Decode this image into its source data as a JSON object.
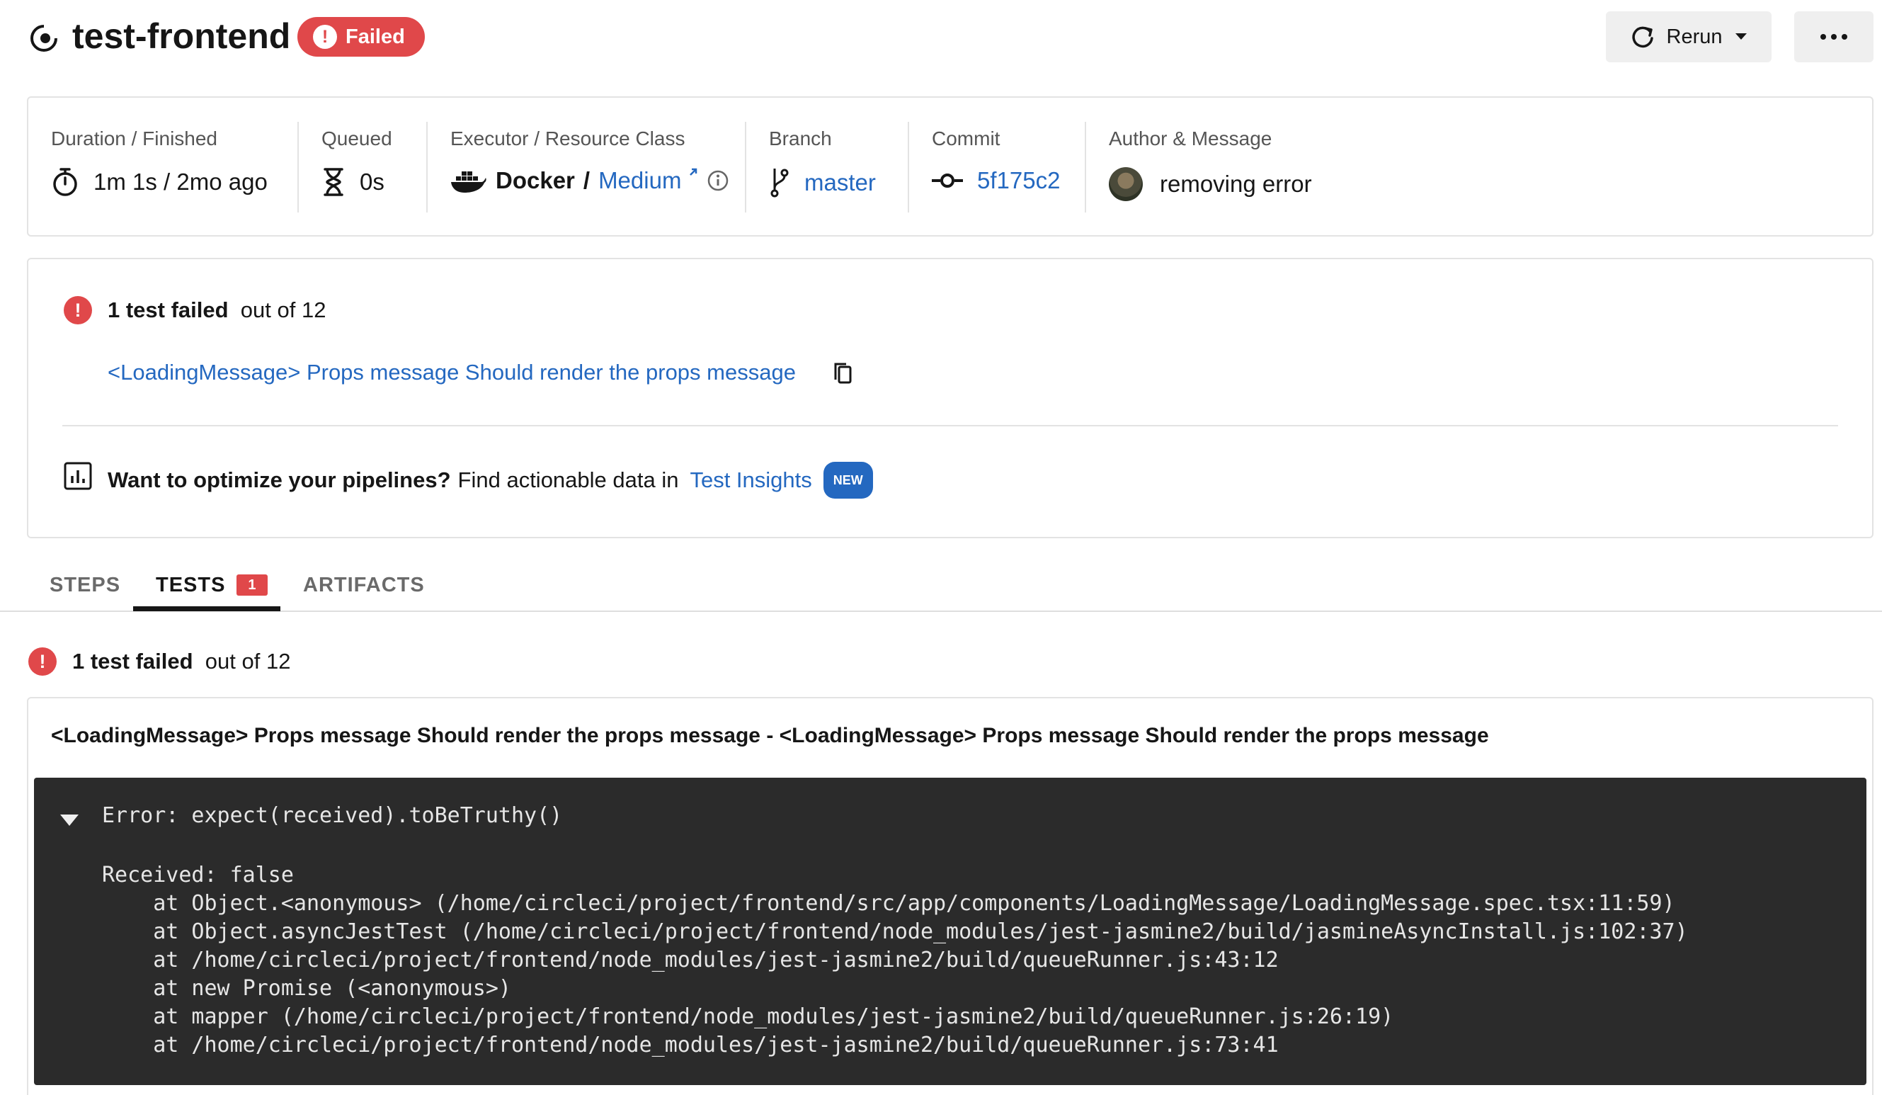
{
  "header": {
    "job_name": "test-frontend",
    "status": "Failed",
    "rerun_label": "Rerun",
    "more_label": "•••"
  },
  "info": {
    "duration_label": "Duration / Finished",
    "duration_value": "1m 1s / 2mo ago",
    "queued_label": "Queued",
    "queued_value": "0s",
    "executor_label": "Executor / Resource Class",
    "executor_value": "Docker",
    "executor_sep": "/",
    "resource_class": "Medium",
    "branch_label": "Branch",
    "branch_value": "master",
    "commit_label": "Commit",
    "commit_value": "5f175c2",
    "author_label": "Author & Message",
    "author_message": "removing error"
  },
  "failed_summary": {
    "count_text": "1 test failed",
    "out_of_text": "out of 12",
    "test_name": "<LoadingMessage> Props message Should render the props message",
    "optimize_bold": "Want to optimize your pipelines?",
    "optimize_text": "Find actionable data in",
    "insights_link": "Test Insights",
    "new_badge": "NEW"
  },
  "tabs": [
    {
      "label": "STEPS"
    },
    {
      "label": "TESTS",
      "count": "1"
    },
    {
      "label": "ARTIFACTS"
    }
  ],
  "results": {
    "count_text": "1 test failed",
    "out_of_text": "out of 12",
    "test_title": "<LoadingMessage> Props message Should render the props message - <LoadingMessage> Props message Should render the props message",
    "error_line": "Error: expect(received).toBeTruthy()",
    "received_line": "Received: false",
    "stack": [
      "    at Object.<anonymous> (/home/circleci/project/frontend/src/app/components/LoadingMessage/LoadingMessage.spec.tsx:11:59)",
      "    at Object.asyncJestTest (/home/circleci/project/frontend/node_modules/jest-jasmine2/build/jasmineAsyncInstall.js:102:37)",
      "    at /home/circleci/project/frontend/node_modules/jest-jasmine2/build/queueRunner.js:43:12",
      "    at new Promise (<anonymous>)",
      "    at mapper (/home/circleci/project/frontend/node_modules/jest-jasmine2/build/queueRunner.js:26:19)",
      "    at /home/circleci/project/frontend/node_modules/jest-jasmine2/build/queueRunner.js:73:41"
    ]
  },
  "colors": {
    "failed_red": "#e0484a",
    "link_blue": "#2468c0",
    "console_bg": "#2b2b2b"
  }
}
